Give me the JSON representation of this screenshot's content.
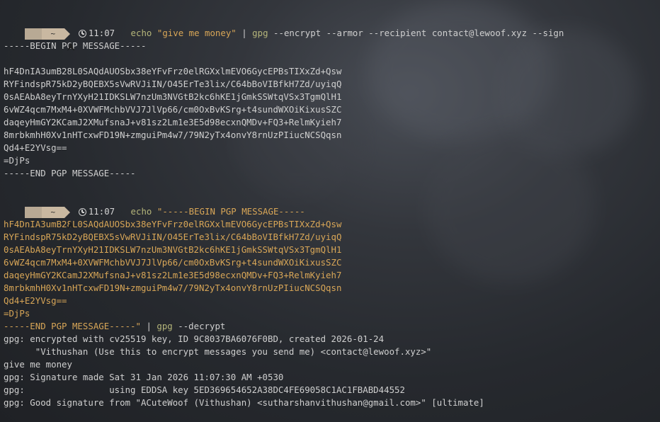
{
  "prompt1": {
    "home_symbol": "~",
    "time": "11:07",
    "cmd_echo": "echo",
    "cmd_string": "\"give me money\"",
    "pipe": "|",
    "cmd_gpg": "gpg",
    "cmd_args": "--encrypt --armor --recipient contact@lewoof.xyz --sign"
  },
  "output1": {
    "begin": "-----BEGIN PGP MESSAGE-----",
    "body": [
      "hF4DnIA3umB28L0SAQdAUOSbx38eYFvFrz0elRGXxlmEVO6GycEPBsTIXxZd+Qsw",
      "RYFindspR75kD2yBQEBX5sVwRVJiIN/O45ErTe3lix/C64bBoVIBfkH7Zd/uyiqQ",
      "0sAEAbA8eyTrnYXyH21IDKSLW7nzUm3NVGtB2kc6hKE1jGmkSSWtqVSx3TgmQlH1",
      "6vWZ4qcm7MxM4+0XVWFMchbVVJ7JlVp66/cm0OxBvKSrg+t4sundWXOiKixusSZC",
      "daqeyHmGY2KCamJ2XMufsnaJ+v81sz2Lm1e3E5d98ecxnQMDv+FQ3+RelmKyieh7",
      "8mrbkmhH0Xv1nHTcxwFD19N+zmguiPm4w7/79N2yTx4onvY8rnUzPIiucNCSQqsn",
      "Qd4+E2YVsg==",
      "=DjPs"
    ],
    "end": "-----END PGP MESSAGE-----"
  },
  "prompt2": {
    "home_symbol": "~",
    "time": "11:07",
    "cmd_echo": "echo",
    "cmd_string_first": "\"-----BEGIN PGP MESSAGE-----",
    "body": [
      "hF4DnIA3umB28L0SAQdAUOSbx38eYFvFrz0elRGXxlmEVO6GycEPBsTIXxZd+Qsw",
      "RYFindspR75kD2yBQEBX5sVwRVJiIN/O45ErTe3lix/C64bBoVIBfkH7Zd/uyiqQ",
      "0sAEAbA8eyTrnYXyH21IDKSLW7nzUm3NVGtB2kc6hKE1jGmkSSWtqVSx3TgmQlH1",
      "6vWZ4qcm7MxM4+0XVWFMchbVVJ7JlVp66/cm0OxBvKSrg+t4sundWXOiKixusSZC",
      "daqeyHmGY2KCamJ2XMufsnaJ+v81sz2Lm1e3E5d98ecxnQMDv+FQ3+RelmKyieh7",
      "8mrbkmhH0Xv1nHTcxwFD19N+zmguiPm4w7/79N2yTx4onvY8rnUzPIiucNCSQqsn",
      "Qd4+E2YVsg==",
      "=DjPs"
    ],
    "cmd_string_end": "-----END PGP MESSAGE-----\"",
    "pipe": "|",
    "cmd_gpg": "gpg",
    "cmd_args": "--decrypt"
  },
  "output2": [
    "gpg: encrypted with cv25519 key, ID 9C8037BA6076F0BD, created 2026-01-24",
    "      \"Vithushan (Use this to encrypt messages you send me) <contact@lewoof.xyz>\"",
    "give me money",
    "gpg: Signature made Sat 31 Jan 2026 11:07:30 AM +0530",
    "gpg:                using EDDSA key 5ED369654652A38DC4FE69058C1AC1FBABD44552",
    "gpg: Good signature from \"ACuteWoof (Vithushan) <sutharshanvithushan@gmail.com>\" [ultimate]"
  ],
  "colors": {
    "background": "#26292e",
    "text": "#cfcfcf",
    "command": "#b5b57a",
    "string": "#d8a657",
    "prompt_segment": "#c9b8a1"
  },
  "icons": [
    "arch-logo-icon",
    "clock-icon"
  ]
}
